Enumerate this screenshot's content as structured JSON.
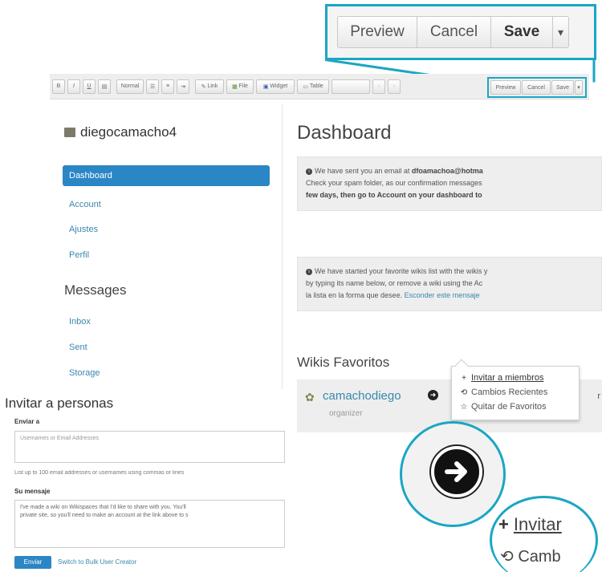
{
  "zoom_toolbar": {
    "preview": "Preview",
    "cancel": "Cancel",
    "save": "Save"
  },
  "editor_toolbar": {
    "style_select": "Normal",
    "link": "Link",
    "file": "File",
    "widget": "Widget",
    "table": "Table",
    "preview": "Preview",
    "cancel": "Cancel",
    "save": "Save"
  },
  "sidebar": {
    "username": "diegocamacho4",
    "items": [
      {
        "label": "Dashboard",
        "active": true
      },
      {
        "label": "Account"
      },
      {
        "label": "Ajustes"
      },
      {
        "label": "Perfil"
      }
    ],
    "messages_title": "Messages",
    "message_items": [
      {
        "label": "Inbox"
      },
      {
        "label": "Sent"
      },
      {
        "label": "Storage"
      }
    ]
  },
  "main": {
    "title": "Dashboard",
    "alert1": {
      "line1_prefix": "We have sent you an email at",
      "line1_email": "dfoamachoa@hotma",
      "line2": "Check your spam folder, as our confirmation messages",
      "line3_bold": "few days, then go to Account on your dashboard to"
    },
    "alert2": {
      "line1": "We have started your favorite wikis list with the wikis y",
      "line2": "by typing its name below, or remove a wiki using the Ac",
      "line3_prefix": "la lista en la forma que desee.",
      "line3_link": "Esconder este mensaje"
    },
    "wikis_title": "Wikis Favoritos",
    "wiki": {
      "name": "camachodiego",
      "role": "organizer",
      "tail": "r"
    }
  },
  "dropdown": {
    "items": [
      {
        "icon": "plus-icon",
        "glyph": "+",
        "label": "Invitar a miembros"
      },
      {
        "icon": "history-icon",
        "glyph": "⟲",
        "label": "Cambios Recientes"
      },
      {
        "icon": "star-icon",
        "glyph": "☆",
        "label": "Quitar de Favoritos"
      }
    ]
  },
  "invite": {
    "title": "Invitar a personas",
    "to_label": "Enviar a",
    "to_placeholder": "Usernames or Email Addresses",
    "to_help": "List up to 100 email addresses or usernames using commas or lines",
    "message_label": "Su mensaje",
    "message_line1": "I've made a wiki on Wikispaces that I'd like to share with you.  You'll",
    "message_line2": "private site, so you'll need to make an account at the link above to s",
    "send_button": "Enviar",
    "bulk_link": "Switch to Bulk User Creator"
  },
  "zoom_circle_b": {
    "item1": "Invitar",
    "item2": "Camb"
  },
  "colors": {
    "callout": "#1aa6c4",
    "nav_active": "#2b86c5",
    "link": "#3a87ad",
    "panel_bg": "#eeeeee"
  }
}
